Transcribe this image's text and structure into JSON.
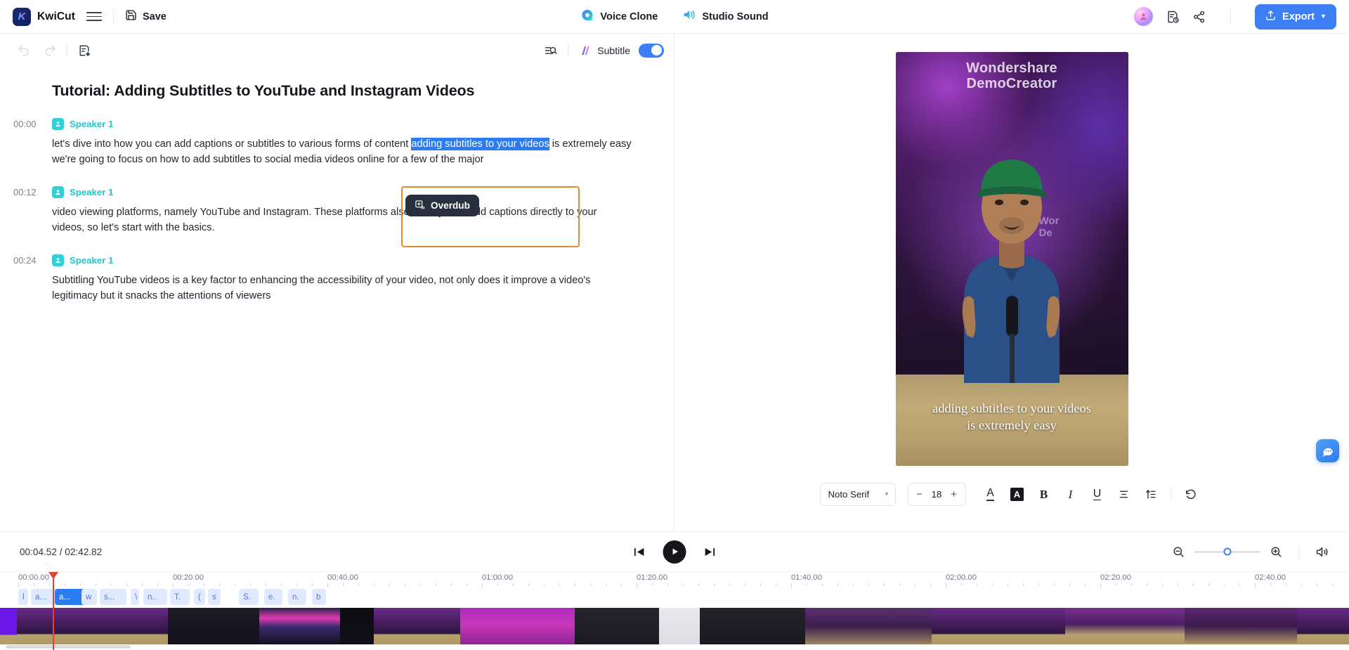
{
  "app": {
    "brand": "KwiCut",
    "logo_letter": "K",
    "accent_blue": "#3b7ef5",
    "accent_orange": "#e08b37",
    "speaker_teal": "#23c5cd"
  },
  "topbar": {
    "menu_icon": "hamburger-icon",
    "save_label": "Save",
    "save_icon": "floppy-disk-icon",
    "center_items": [
      {
        "label": "Voice Clone",
        "icon": "voice-clone-icon"
      },
      {
        "label": "Studio Sound",
        "icon": "studio-sound-icon"
      }
    ],
    "avatar_icon": "user-avatar",
    "history_icon": "document-clock-icon",
    "share_icon": "share-nodes-icon",
    "export_label": "Export",
    "export_icon": "upload-icon",
    "export_chevron": "▾"
  },
  "editor_toolbar": {
    "undo_icon": "undo-icon",
    "redo_icon": "redo-icon",
    "ai_doc_icon": "document-sparkle-icon",
    "search_icon": "search-text-icon",
    "ai_subtitle_icon": "ai-magic-icon",
    "subtitle_label": "Subtitle",
    "subtitle_toggle_on": true
  },
  "transcript": {
    "title": "Tutorial: Adding Subtitles to YouTube and Instagram Videos",
    "paragraphs": [
      {
        "time": "00:00",
        "speaker": "Speaker 1",
        "text_before": "let's dive into how you can add captions or subtitles to various forms of content ",
        "selected_text": "adding subtitles to your videos",
        "text_after": " is extremely easy we're going to focus on how to add subtitles to social media videos online for a few of the major"
      },
      {
        "time": "00:12",
        "speaker": "Speaker 1",
        "text_before": "video viewing platforms, namely YouTube and Instagram. These platforms also allow you to add captions directly to your videos, so let's start with the basics.",
        "selected_text": "",
        "text_after": ""
      },
      {
        "time": "00:24",
        "speaker": "Speaker 1",
        "text_before": "Subtitling YouTube videos is a key factor to enhancing the accessibility of your video, not only does it improve a video's legitimacy but it snacks the attentions of viewers",
        "selected_text": "",
        "text_after": ""
      }
    ],
    "overdub_label": "Overdub",
    "overdub_icon": "overdub-icon"
  },
  "preview": {
    "watermark_line1": "Wondershare",
    "watermark_line2": "DemoCreator",
    "watermark_small_line1": "Wor",
    "watermark_small_line2": "De",
    "caption_line1": "adding subtitles to your videos",
    "caption_line2": "is extremely easy"
  },
  "format_bar": {
    "font_family_value": "Noto Serif",
    "font_size_value": "18",
    "decrease_label": "−",
    "increase_label": "+",
    "text_color_label": "A",
    "highlight_label": "A",
    "bold_label": "B",
    "italic_label": "I",
    "underline_label": "U",
    "align_icon": "align-center-icon",
    "line_height_icon": "line-height-icon",
    "reset_icon": "reset-icon"
  },
  "chat": {
    "icon": "chat-bubble-icon"
  },
  "playback": {
    "current_time": "00:04.52",
    "separator": "/",
    "total_time": "02:42.82",
    "prev_frame_icon": "previous-frame-icon",
    "play_icon": "play-icon",
    "next_frame_icon": "next-frame-icon",
    "zoom_out_icon": "zoom-out-icon",
    "zoom_in_icon": "zoom-in-icon",
    "zoom_value": 50,
    "volume_icon": "volume-icon"
  },
  "timeline": {
    "ruler_labels": [
      "00:00.00",
      "00:20.00",
      "00:40.00",
      "01:00.00",
      "01:20.00",
      "01:40.00",
      "02:00.00",
      "02:20.00",
      "02:40.00"
    ],
    "playhead_position": "00:04.52",
    "chips": [
      {
        "label": "l",
        "active": false
      },
      {
        "label": "a...",
        "active": false
      },
      {
        "label": "a...",
        "active": true
      },
      {
        "label": "w",
        "active": false
      },
      {
        "label": "s...",
        "active": false
      },
      {
        "label": "\\",
        "active": false
      },
      {
        "label": "n..",
        "active": false
      },
      {
        "label": "T.",
        "active": false
      },
      {
        "label": "(",
        "active": false
      },
      {
        "label": "s",
        "active": false
      },
      {
        "label": "S.",
        "active": false
      },
      {
        "label": "e.",
        "active": false
      },
      {
        "label": "n.",
        "active": false
      },
      {
        "label": "b",
        "active": false
      }
    ]
  }
}
